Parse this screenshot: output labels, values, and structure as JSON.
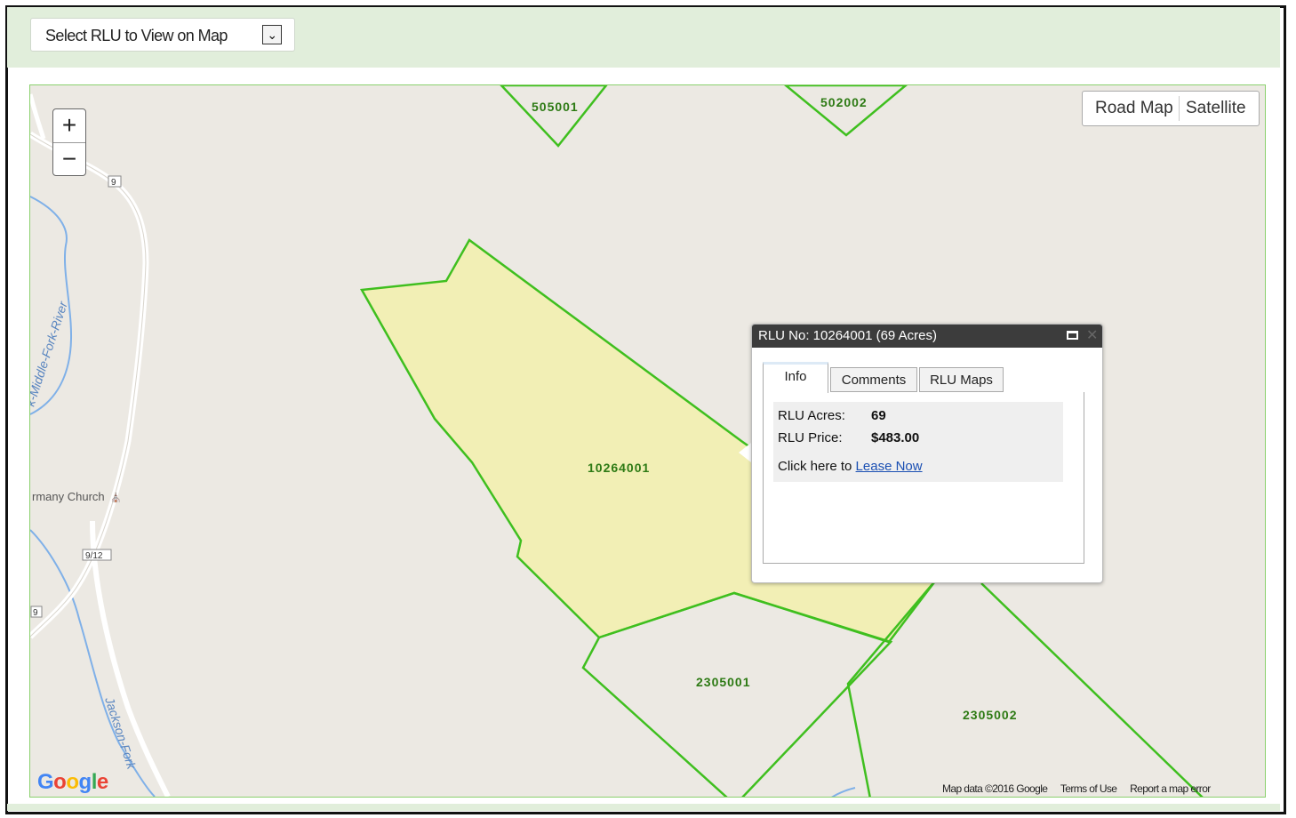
{
  "selector": {
    "label": "Select RLU to View on Map",
    "arrow_glyph": "⌄"
  },
  "map": {
    "zoom_in": "+",
    "zoom_out": "−",
    "map_type_buttons": [
      "Road Map",
      "Satellite"
    ],
    "parcel_labels": {
      "p505001": "505001",
      "p502002": "502002",
      "p10264001": "10264001",
      "p2305001": "2305001",
      "p2305002": "2305002"
    },
    "place_labels": {
      "river": "k-Middle-Fork-River",
      "church": "rmany Church",
      "creek": "Jackson-Fork",
      "road9a": "9",
      "road912": "9/12",
      "road9b": "9"
    },
    "attribution": [
      "Map data ©2016 Google",
      "Terms of Use",
      "Report a map error"
    ],
    "logo_text": "Google",
    "colors": {
      "parcel_outline": "#3fbf1f",
      "parcel_selected_fill": "#f2efb5",
      "river": "#7fb0e8",
      "road": "#ffffff",
      "background": "#ece9e3"
    }
  },
  "popup": {
    "title": "RLU No: 10264001 (69 Acres)",
    "tabs": [
      "Info",
      "Comments",
      "RLU Maps"
    ],
    "active_tab": "Info",
    "acres_label": "RLU Acres:",
    "acres_value": "69",
    "price_label": "RLU Price:",
    "price_value": "$483.00",
    "lease_prefix": "Click here to",
    "lease_link": "Lease Now"
  }
}
